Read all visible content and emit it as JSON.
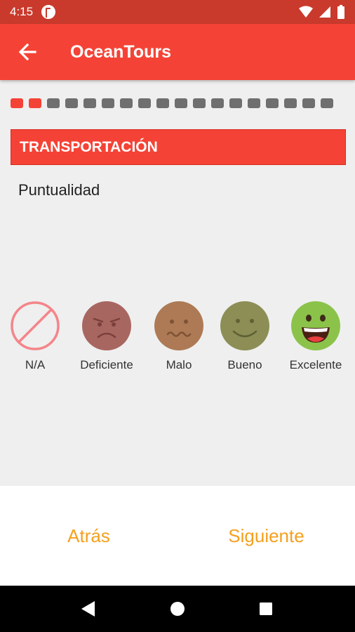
{
  "status_bar": {
    "time": "4:15"
  },
  "app_bar": {
    "title": "OceanTours"
  },
  "progress": {
    "completed": 2,
    "total": 18
  },
  "section": {
    "title": "TRANSPORTACIÓN"
  },
  "question": {
    "text": "Puntualidad"
  },
  "ratings": [
    {
      "label": "N/A",
      "icon": "na-icon"
    },
    {
      "label": "Deficiente",
      "icon": "angry-face-icon"
    },
    {
      "label": "Malo",
      "icon": "worried-face-icon"
    },
    {
      "label": "Bueno",
      "icon": "smile-face-icon"
    },
    {
      "label": "Excelente",
      "icon": "grin-face-icon"
    }
  ],
  "footer": {
    "back_label": "Atrás",
    "next_label": "Siguiente"
  },
  "colors": {
    "primary": "#f44336",
    "status_bar": "#c93a2c",
    "accent": "#f5a01e"
  }
}
